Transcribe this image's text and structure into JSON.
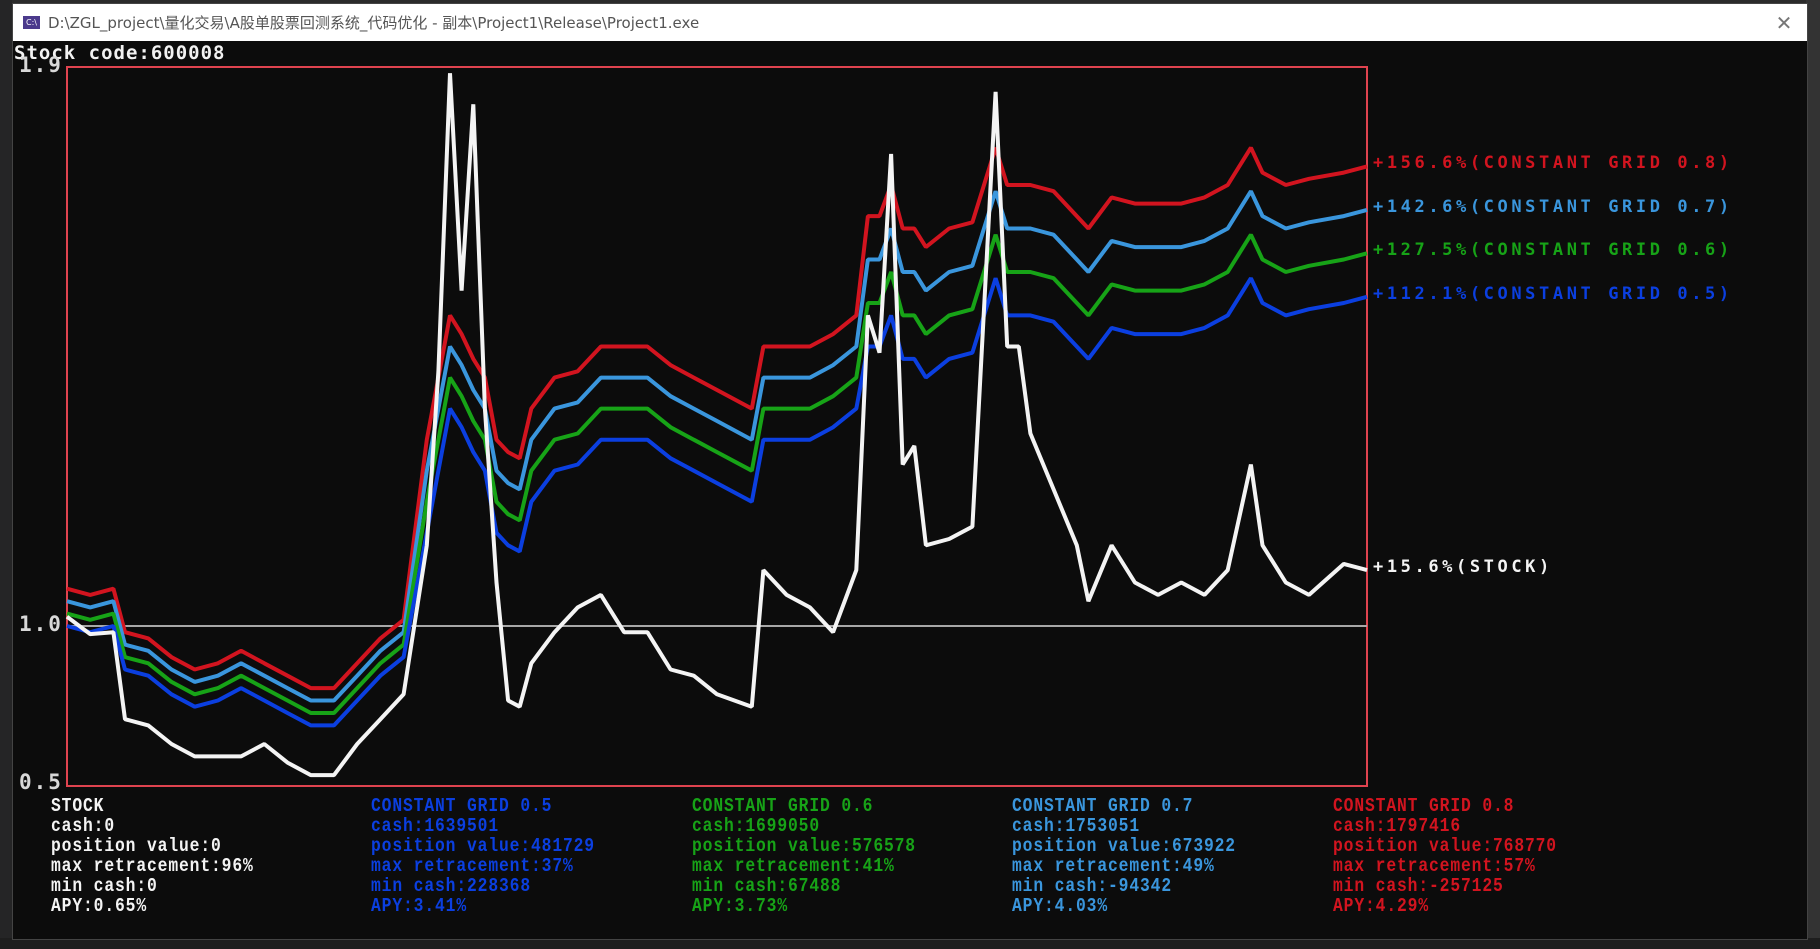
{
  "window": {
    "title": "D:\\ZGL_project\\量化交易\\A股单股票回测系统_代码优化 - 副本\\Project1\\Release\\Project1.exe",
    "icon": "console-app-icon",
    "close": "✕"
  },
  "header": {
    "stock_code_label": "Stock code:",
    "stock_code": "600008"
  },
  "colors": {
    "stock": "#f4f4f4",
    "grid_0_5": "#0b3fe0",
    "grid_0_6": "#17a317",
    "grid_0_7": "#3a96dd",
    "grid_0_8": "#d2141f",
    "frame": "#e0434f",
    "baseline": "#a8a8a8"
  },
  "chart_data": {
    "type": "line",
    "title": "Stock code:600008",
    "y_tick_labels": [
      {
        "value": 1.9,
        "label": "1.9"
      },
      {
        "value": 1.0,
        "label": "1.0"
      },
      {
        "value": 0.742,
        "label": "0.5"
      }
    ],
    "ylim": [
      0.742,
      1.9
    ],
    "baseline": 1.0,
    "x": [
      0,
      20,
      40,
      50,
      70,
      90,
      110,
      130,
      150,
      170,
      190,
      210,
      230,
      250,
      270,
      290,
      310,
      320,
      330,
      340,
      350,
      360,
      370,
      380,
      390,
      400,
      420,
      440,
      460,
      480,
      500,
      520,
      540,
      560,
      590,
      600,
      620,
      640,
      660,
      680,
      690,
      700,
      710,
      720,
      730,
      740,
      760,
      780,
      800,
      810,
      820,
      830,
      850,
      870,
      880,
      900,
      920,
      940,
      960,
      980,
      1000,
      1020,
      1030,
      1050,
      1070,
      1100,
      1120
    ],
    "series": [
      {
        "key": "grid_0_8",
        "name": "CONSTANT GRID 0.8",
        "end_label": "+156.6%(CONSTANT GRID 0.8)",
        "values": [
          1.06,
          1.05,
          1.06,
          0.99,
          0.98,
          0.95,
          0.93,
          0.94,
          0.96,
          0.94,
          0.92,
          0.9,
          0.9,
          0.94,
          0.98,
          1.01,
          1.3,
          1.4,
          1.5,
          1.47,
          1.43,
          1.4,
          1.3,
          1.28,
          1.27,
          1.35,
          1.4,
          1.41,
          1.45,
          1.45,
          1.45,
          1.42,
          1.4,
          1.38,
          1.35,
          1.45,
          1.45,
          1.45,
          1.47,
          1.5,
          1.66,
          1.66,
          1.71,
          1.64,
          1.64,
          1.61,
          1.64,
          1.65,
          1.77,
          1.71,
          1.71,
          1.71,
          1.7,
          1.66,
          1.64,
          1.69,
          1.68,
          1.68,
          1.68,
          1.69,
          1.71,
          1.77,
          1.73,
          1.71,
          1.72,
          1.73,
          1.74
        ]
      },
      {
        "key": "grid_0_7",
        "name": "CONSTANT GRID 0.7",
        "end_label": "+142.6%(CONSTANT GRID 0.7)",
        "values": [
          1.04,
          1.03,
          1.04,
          0.97,
          0.96,
          0.93,
          0.91,
          0.92,
          0.94,
          0.92,
          0.9,
          0.88,
          0.88,
          0.92,
          0.96,
          0.99,
          1.25,
          1.35,
          1.45,
          1.42,
          1.38,
          1.35,
          1.25,
          1.23,
          1.22,
          1.3,
          1.35,
          1.36,
          1.4,
          1.4,
          1.4,
          1.37,
          1.35,
          1.33,
          1.3,
          1.4,
          1.4,
          1.4,
          1.42,
          1.45,
          1.59,
          1.59,
          1.64,
          1.57,
          1.57,
          1.54,
          1.57,
          1.58,
          1.7,
          1.64,
          1.64,
          1.64,
          1.63,
          1.59,
          1.57,
          1.62,
          1.61,
          1.61,
          1.61,
          1.62,
          1.64,
          1.7,
          1.66,
          1.64,
          1.65,
          1.66,
          1.67
        ]
      },
      {
        "key": "grid_0_6",
        "name": "CONSTANT GRID 0.6",
        "end_label": "+127.5%(CONSTANT GRID 0.6)",
        "values": [
          1.02,
          1.01,
          1.02,
          0.95,
          0.94,
          0.91,
          0.89,
          0.9,
          0.92,
          0.9,
          0.88,
          0.86,
          0.86,
          0.9,
          0.94,
          0.97,
          1.2,
          1.3,
          1.4,
          1.37,
          1.33,
          1.3,
          1.2,
          1.18,
          1.17,
          1.25,
          1.3,
          1.31,
          1.35,
          1.35,
          1.35,
          1.32,
          1.3,
          1.28,
          1.25,
          1.35,
          1.35,
          1.35,
          1.37,
          1.4,
          1.52,
          1.52,
          1.57,
          1.5,
          1.5,
          1.47,
          1.5,
          1.51,
          1.63,
          1.57,
          1.57,
          1.57,
          1.56,
          1.52,
          1.5,
          1.55,
          1.54,
          1.54,
          1.54,
          1.55,
          1.57,
          1.63,
          1.59,
          1.57,
          1.58,
          1.59,
          1.6
        ]
      },
      {
        "key": "grid_0_5",
        "name": "CONSTANT GRID 0.5",
        "end_label": "+112.1%(CONSTANT GRID 0.5)",
        "values": [
          1.0,
          0.99,
          1.0,
          0.93,
          0.92,
          0.89,
          0.87,
          0.88,
          0.9,
          0.88,
          0.86,
          0.84,
          0.84,
          0.88,
          0.92,
          0.95,
          1.15,
          1.25,
          1.35,
          1.32,
          1.28,
          1.25,
          1.15,
          1.13,
          1.12,
          1.2,
          1.25,
          1.26,
          1.3,
          1.3,
          1.3,
          1.27,
          1.25,
          1.23,
          1.2,
          1.3,
          1.3,
          1.3,
          1.32,
          1.35,
          1.45,
          1.45,
          1.5,
          1.43,
          1.43,
          1.4,
          1.43,
          1.44,
          1.56,
          1.5,
          1.5,
          1.5,
          1.49,
          1.45,
          1.43,
          1.48,
          1.47,
          1.47,
          1.47,
          1.48,
          1.5,
          1.56,
          1.52,
          1.5,
          1.51,
          1.52,
          1.53
        ]
      },
      {
        "key": "stock",
        "name": "STOCK",
        "end_label": "+15.6%(STOCK)",
        "values": [
          1.015,
          0.987,
          0.99,
          0.85,
          0.84,
          0.81,
          0.79,
          0.79,
          0.79,
          0.81,
          0.78,
          0.76,
          0.76,
          0.81,
          0.85,
          0.89,
          1.13,
          1.41,
          1.89,
          1.54,
          1.84,
          1.35,
          1.07,
          0.88,
          0.87,
          0.94,
          0.99,
          1.03,
          1.05,
          0.99,
          0.99,
          0.93,
          0.92,
          0.89,
          0.87,
          1.09,
          1.05,
          1.03,
          0.99,
          1.09,
          1.5,
          1.44,
          1.76,
          1.26,
          1.29,
          1.13,
          1.14,
          1.16,
          1.86,
          1.45,
          1.45,
          1.31,
          1.22,
          1.13,
          1.04,
          1.13,
          1.07,
          1.05,
          1.07,
          1.05,
          1.09,
          1.26,
          1.13,
          1.07,
          1.05,
          1.1,
          1.09
        ]
      }
    ]
  },
  "stats": [
    {
      "key": "stock",
      "title": "STOCK",
      "cash": "cash:0",
      "position_value": "position value:0",
      "max_retracement": "max retracement:96%",
      "min_cash": "min cash:0",
      "apy": "APY:0.65%"
    },
    {
      "key": "grid_0_5",
      "title": "CONSTANT GRID 0.5",
      "cash": "cash:1639501",
      "position_value": "position value:481729",
      "max_retracement": "max retracement:37%",
      "min_cash": "min cash:228368",
      "apy": "APY:3.41%"
    },
    {
      "key": "grid_0_6",
      "title": "CONSTANT GRID 0.6",
      "cash": "cash:1699050",
      "position_value": "position value:576578",
      "max_retracement": "max retracement:41%",
      "min_cash": "min cash:67488",
      "apy": "APY:3.73%"
    },
    {
      "key": "grid_0_7",
      "title": "CONSTANT GRID 0.7",
      "cash": "cash:1753051",
      "position_value": "position value:673922",
      "max_retracement": "max retracement:49%",
      "min_cash": "min cash:-94342",
      "apy": "APY:4.03%"
    },
    {
      "key": "grid_0_8",
      "title": "CONSTANT GRID 0.8",
      "cash": "cash:1797416",
      "position_value": "position value:768770",
      "max_retracement": "max retracement:57%",
      "min_cash": "min cash:-257125",
      "apy": "APY:4.29%"
    }
  ]
}
